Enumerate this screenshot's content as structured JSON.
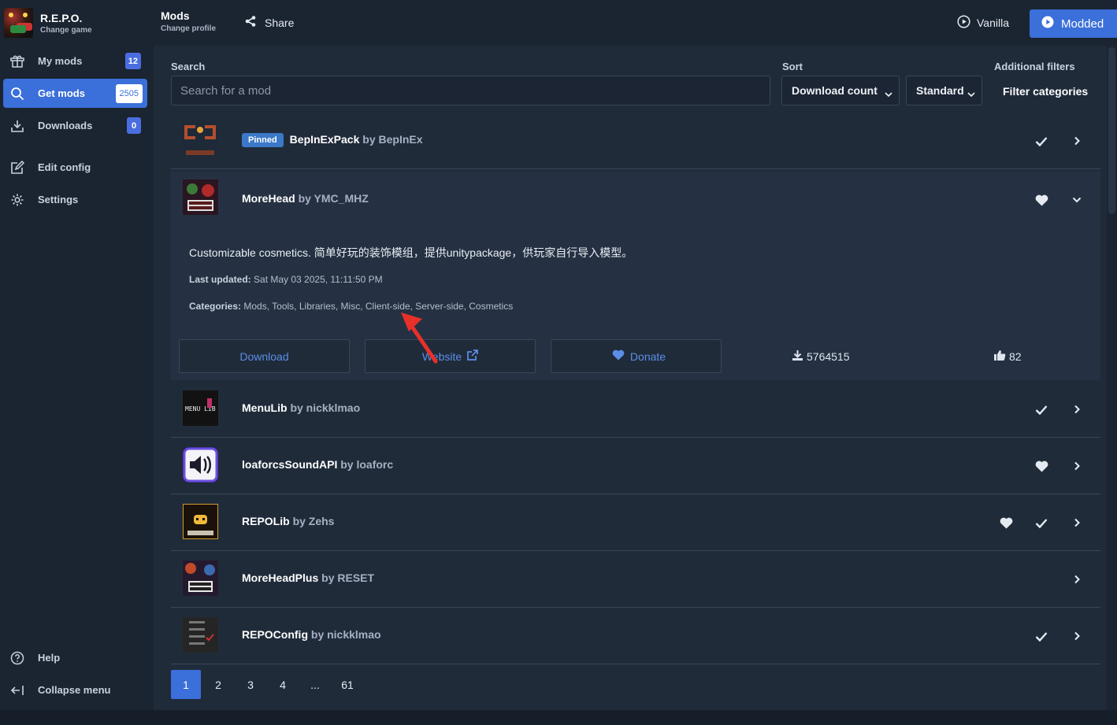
{
  "game": {
    "title": "R.E.P.O.",
    "subtitle": "Change game"
  },
  "sidebar": {
    "items": [
      {
        "label": "My mods",
        "badge": "12",
        "icon": "package-icon"
      },
      {
        "label": "Get mods",
        "badge": "2505",
        "icon": "search-icon",
        "active": true
      },
      {
        "label": "Downloads",
        "badge": "0",
        "icon": "download-icon"
      },
      {
        "label": "Edit config",
        "icon": "edit-icon"
      },
      {
        "label": "Settings",
        "icon": "gear-icon"
      }
    ],
    "footer": [
      {
        "label": "Help",
        "icon": "help-icon"
      },
      {
        "label": "Collapse menu",
        "icon": "collapse-icon"
      }
    ]
  },
  "header": {
    "profile_title": "Mods",
    "profile_subtitle": "Change profile",
    "share_label": "Share",
    "vanilla_label": "Vanilla",
    "modded_label": "Modded"
  },
  "filters": {
    "search_label": "Search",
    "search_placeholder": "Search for a mod",
    "sort_label": "Sort",
    "sort_value": "Download count",
    "order_value": "Standard",
    "additional_label": "Additional filters",
    "filter_categories": "Filter categories"
  },
  "mods": [
    {
      "name": "BepInExPack",
      "by": "by BepInEx",
      "pinned": "Pinned",
      "icons": [
        "check-icon"
      ]
    },
    {
      "name": "MoreHead",
      "by": "by YMC_MHZ",
      "icons": [
        "heart-icon"
      ]
    },
    {
      "name": "MenuLib",
      "by": "by nickklmao",
      "icons": [
        "check-icon"
      ]
    },
    {
      "name": "loaforcsSoundAPI",
      "by": "by loaforc",
      "icons": [
        "heart-icon"
      ]
    },
    {
      "name": "REPOLib",
      "by": "by Zehs",
      "icons": [
        "heart-icon",
        "check-icon"
      ]
    },
    {
      "name": "MoreHeadPlus",
      "by": "by RESET",
      "icons": []
    },
    {
      "name": "REPOConfig",
      "by": "by nickklmao",
      "icons": [
        "check-icon"
      ]
    }
  ],
  "expanded": {
    "description": "Customizable cosmetics. 简单好玩的装饰模组，提供unitypackage，供玩家自行导入模型。",
    "last_updated_label": "Last updated:",
    "last_updated_value": "Sat May 03 2025, 11:11:50 PM",
    "categories_label": "Categories:",
    "categories_value": "Mods, Tools, Libraries, Misc, Client-side, Server-side, Cosmetics",
    "download_label": "Download",
    "website_label": "Website",
    "donate_label": "Donate",
    "downloads_count": "5764515",
    "likes_count": "82"
  },
  "pagination": {
    "pages": [
      "1",
      "2",
      "3",
      "4",
      "...",
      "61"
    ],
    "current": "1"
  },
  "colors": {
    "accent": "#3b6fd9",
    "bg": "#1b2431",
    "panel": "#202b3a",
    "link": "#5b8ee6",
    "annotation": "#e8302a"
  }
}
